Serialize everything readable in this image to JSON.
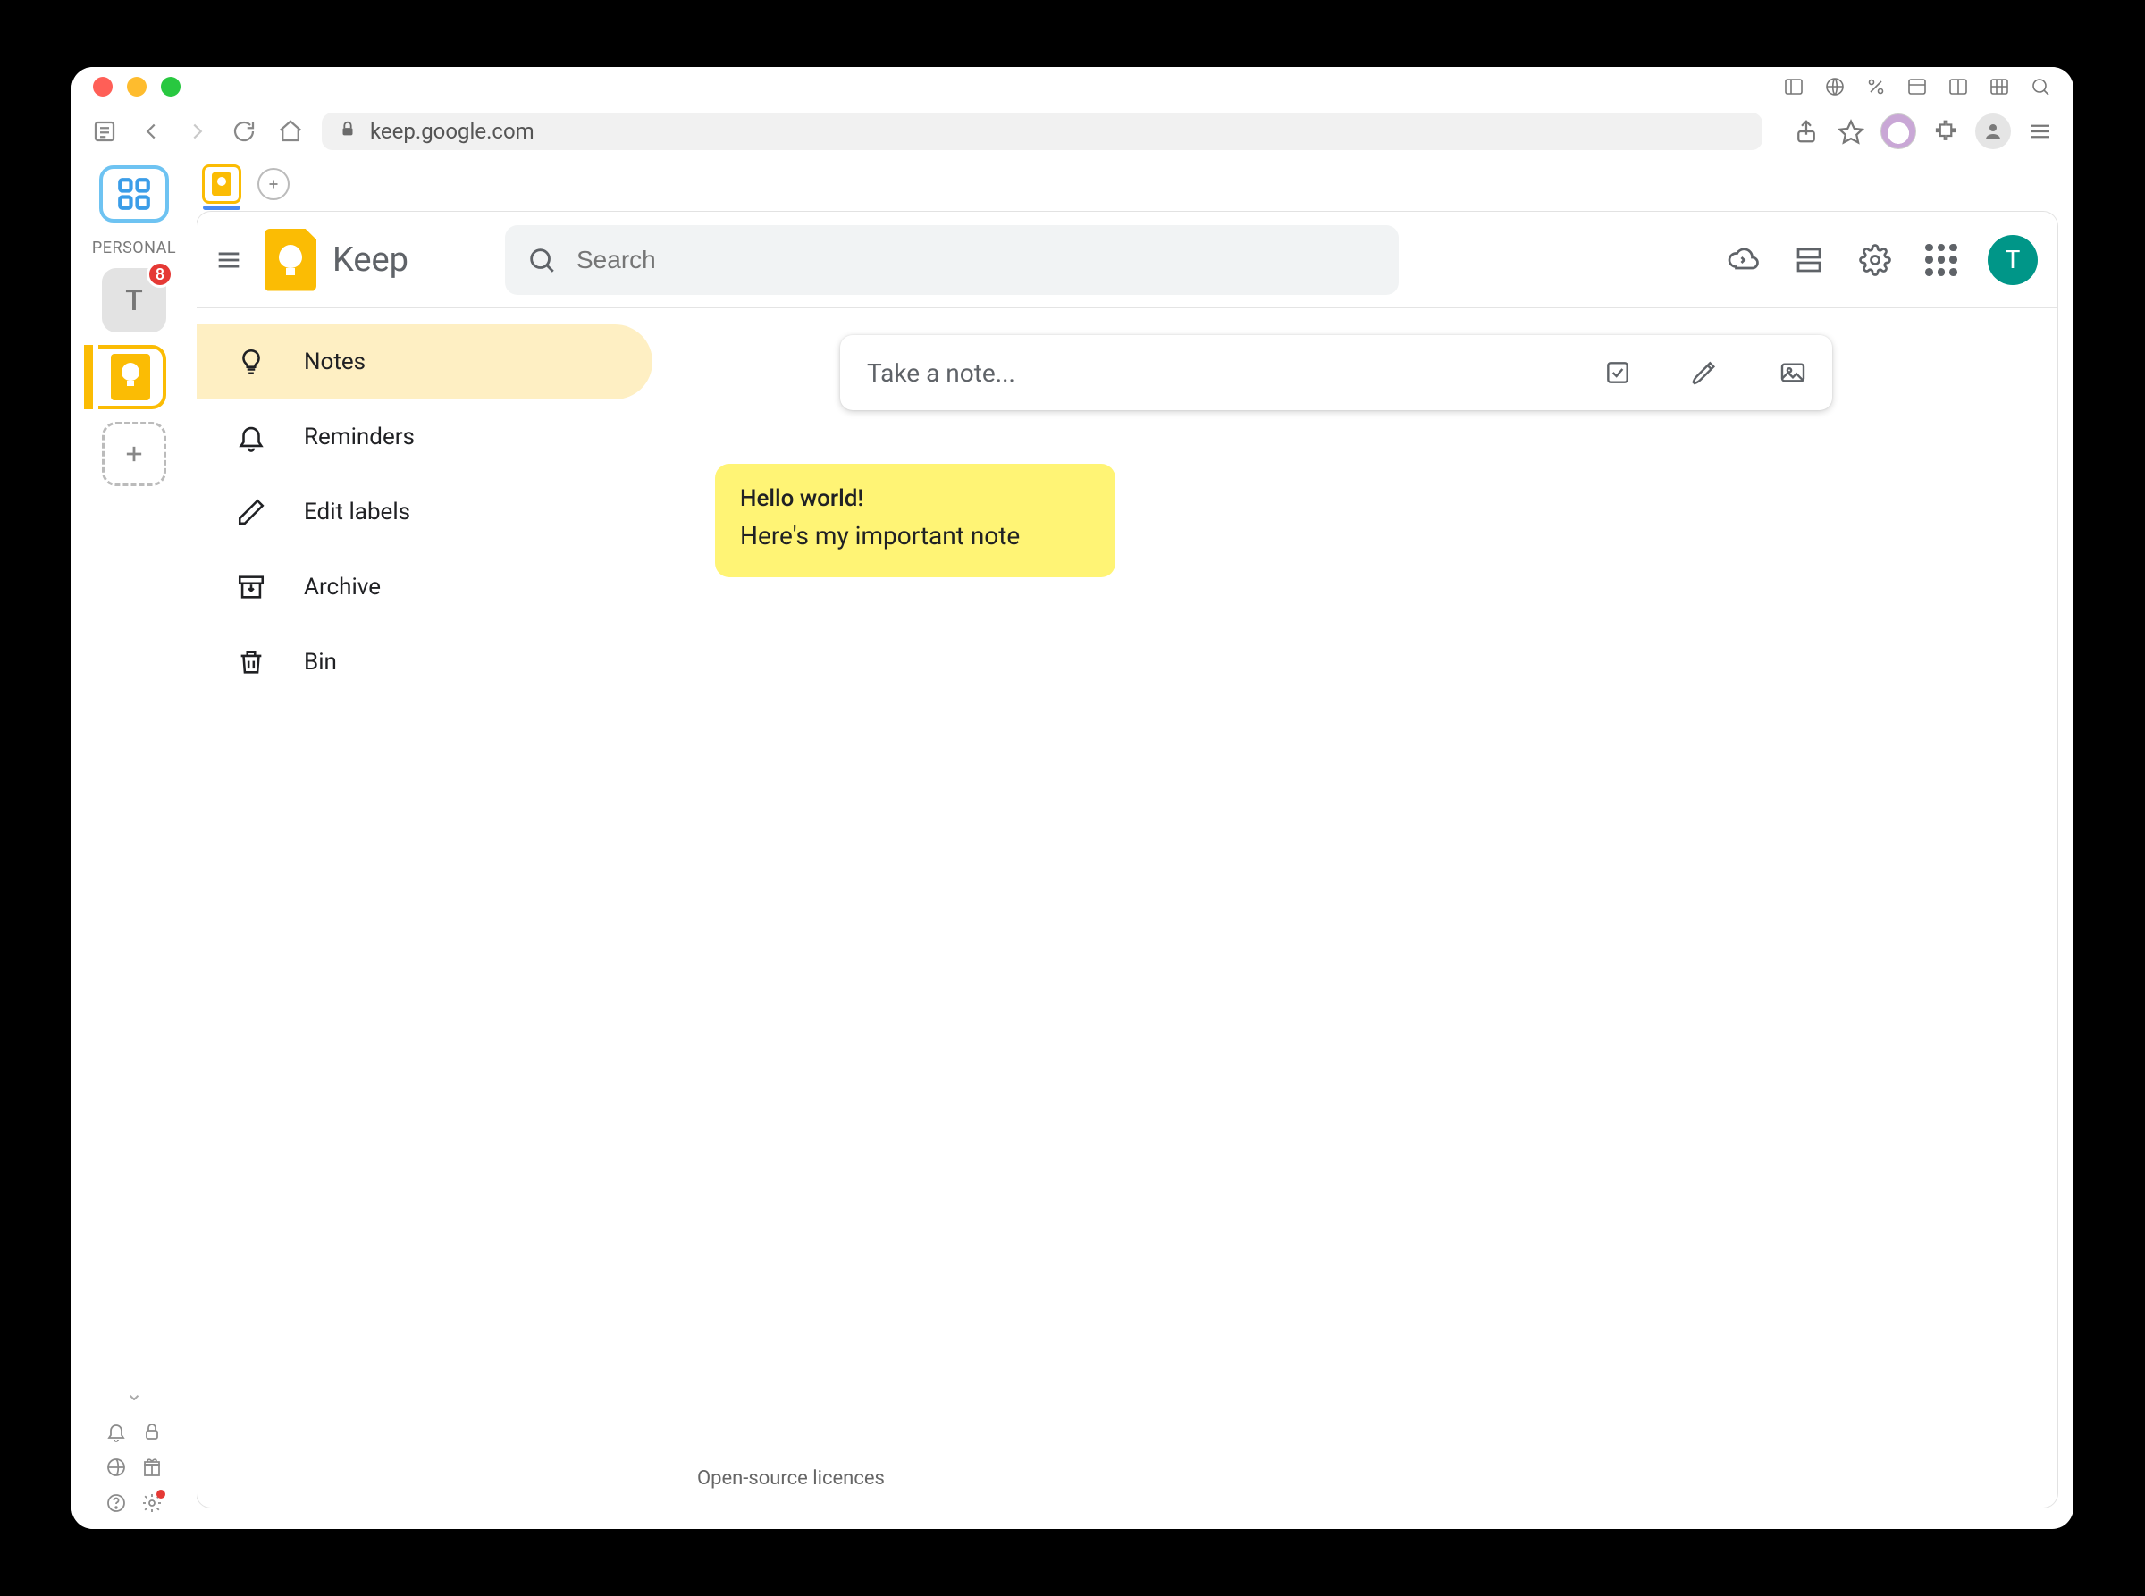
{
  "browser": {
    "url": "keep.google.com",
    "leftbar_label": "PERSONAL",
    "workspace_initial": "T",
    "workspace_badge": "8"
  },
  "keep": {
    "app_name": "Keep",
    "search_placeholder": "Search",
    "user_initial": "T",
    "nav": {
      "notes": "Notes",
      "reminders": "Reminders",
      "edit_labels": "Edit labels",
      "archive": "Archive",
      "bin": "Bin"
    },
    "take_note_placeholder": "Take a note...",
    "note": {
      "title": "Hello world!",
      "body": "Here's my important note"
    },
    "footer": "Open-source licences"
  }
}
